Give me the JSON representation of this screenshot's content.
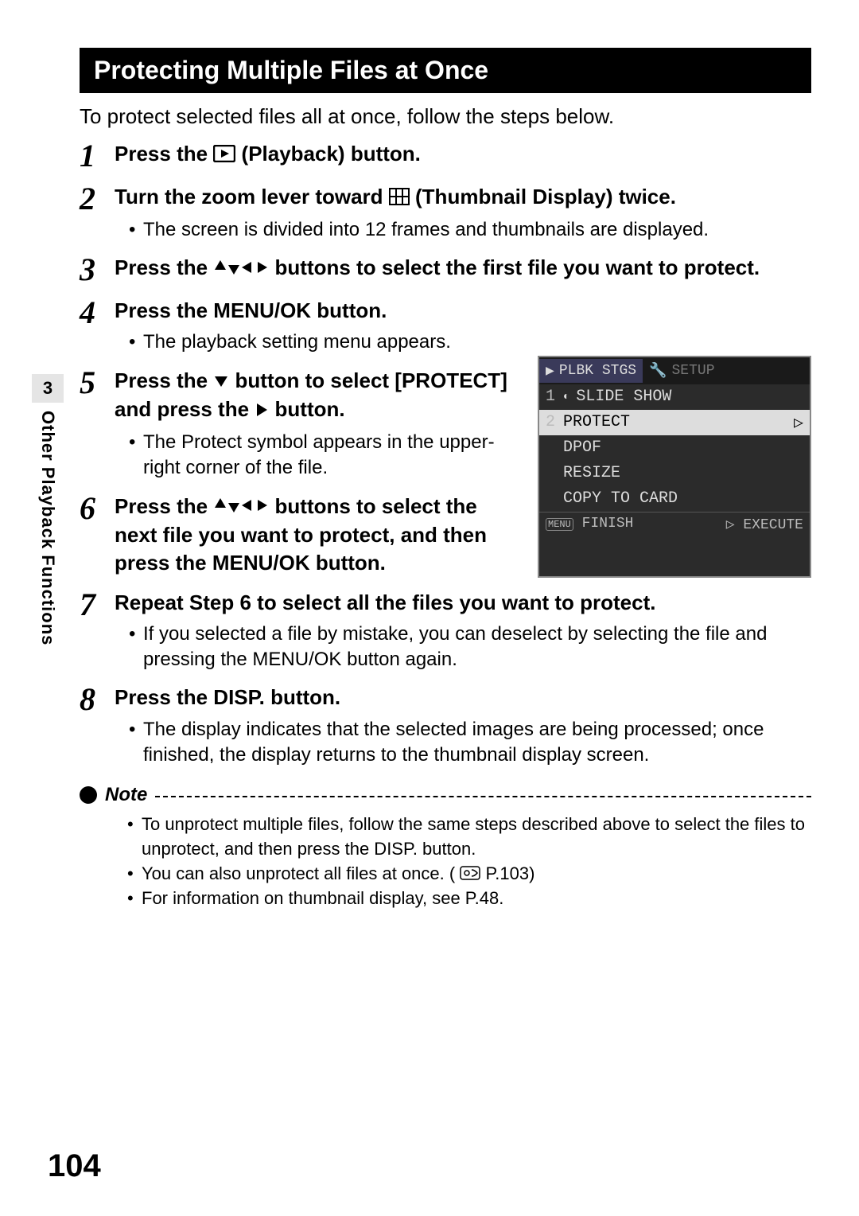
{
  "section_tab": {
    "number": "3",
    "label": "Other Playback Functions"
  },
  "title": "Protecting Multiple Files at Once",
  "intro": "To protect selected files all at once, follow the steps below.",
  "steps": {
    "s1": {
      "num": "1",
      "title_a": "Press the ",
      "title_b": " (Playback) button."
    },
    "s2": {
      "num": "2",
      "title_a": "Turn the zoom lever toward ",
      "title_b": " (Thumbnail Display) twice.",
      "sub1": "The screen is divided into 12 frames and thumbnails are displayed."
    },
    "s3": {
      "num": "3",
      "title_a": "Press the ",
      "title_b": " buttons to select the first file you want to protect."
    },
    "s4": {
      "num": "4",
      "title": "Press the MENU/OK button.",
      "sub1": "The playback setting menu appears."
    },
    "s5": {
      "num": "5",
      "title_a": "Press the ",
      "title_b": " button to select [PROTECT] and press the ",
      "title_c": " button.",
      "sub1": "The Protect symbol appears in the upper-right corner of the file."
    },
    "s6": {
      "num": "6",
      "title_a": "Press the ",
      "title_b": " buttons to select the next file you want to protect, and then press the MENU/OK button."
    },
    "s7": {
      "num": "7",
      "title": "Repeat Step 6 to select all the files you want to protect.",
      "sub1": "If you selected a file by mistake, you can deselect by selecting the file and pressing the MENU/OK button again."
    },
    "s8": {
      "num": "8",
      "title": "Press the DISP. button.",
      "sub1": "The display indicates that the selected images are being processed; once finished, the display returns to the thumbnail display screen."
    }
  },
  "lcd": {
    "tab_active": "PLBK STGS",
    "tab_inactive": "SETUP",
    "items": [
      {
        "idx": "1",
        "label": "SLIDE SHOW"
      },
      {
        "idx": "2",
        "label": "PROTECT"
      },
      {
        "idx": "",
        "label": "DPOF"
      },
      {
        "idx": "",
        "label": "RESIZE"
      },
      {
        "idx": "",
        "label": "COPY TO CARD"
      }
    ],
    "foot_left": "FINISH",
    "foot_right": "EXECUTE"
  },
  "note": {
    "heading": "Note",
    "n1": "To unprotect multiple files, follow the same steps described above to select the files to unprotect, and then press the DISP. button.",
    "n2_a": "You can also unprotect all files at once. (",
    "n2_b": "P.103)",
    "n3": "For information on thumbnail display, see P.48."
  },
  "page_number": "104"
}
